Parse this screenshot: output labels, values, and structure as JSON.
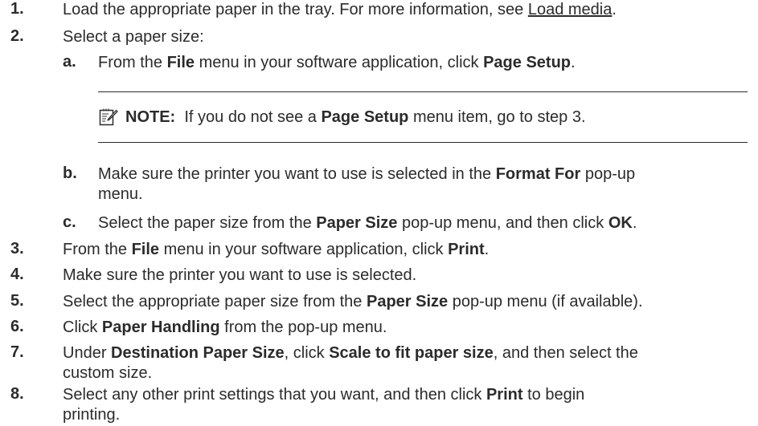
{
  "steps": [
    {
      "num": "1.",
      "parts": [
        {
          "t": "Load the appropriate paper in the tray. For more information, see "
        },
        {
          "t": "Load media",
          "link": true
        },
        {
          "t": "."
        }
      ]
    },
    {
      "num": "2.",
      "parts": [
        {
          "t": "Select a paper size:"
        }
      ]
    },
    {
      "num": "a.",
      "sub": true,
      "parts": [
        {
          "t": "From the "
        },
        {
          "t": "File",
          "b": true
        },
        {
          "t": " menu in your software application, click "
        },
        {
          "t": "Page Setup",
          "b": true
        },
        {
          "t": "."
        }
      ]
    },
    {
      "num": "b.",
      "sub": true,
      "parts": [
        {
          "t": "Make sure the printer you want to use is selected in the "
        },
        {
          "t": "Format For",
          "b": true
        },
        {
          "t": " pop-up"
        },
        {
          "br": true
        },
        {
          "t": "menu."
        }
      ]
    },
    {
      "num": "c.",
      "sub": true,
      "parts": [
        {
          "t": "Select the paper size from the "
        },
        {
          "t": "Paper Size",
          "b": true
        },
        {
          "t": " pop-up menu, and then click "
        },
        {
          "t": "OK",
          "b": true
        },
        {
          "t": "."
        }
      ]
    },
    {
      "num": "3.",
      "parts": [
        {
          "t": "From the "
        },
        {
          "t": "File",
          "b": true
        },
        {
          "t": " menu in your software application, click "
        },
        {
          "t": "Print",
          "b": true
        },
        {
          "t": "."
        }
      ]
    },
    {
      "num": "4.",
      "parts": [
        {
          "t": "Make sure the printer you want to use is selected."
        }
      ]
    },
    {
      "num": "5.",
      "parts": [
        {
          "t": "Select the appropriate paper size from the "
        },
        {
          "t": "Paper Size",
          "b": true
        },
        {
          "t": " pop-up menu (if available)."
        }
      ]
    },
    {
      "num": "6.",
      "parts": [
        {
          "t": "Click "
        },
        {
          "t": "Paper Handling",
          "b": true
        },
        {
          "t": " from the pop-up menu."
        }
      ]
    },
    {
      "num": "7.",
      "parts": [
        {
          "t": "Under "
        },
        {
          "t": "Destination Paper Size",
          "b": true
        },
        {
          "t": ", click "
        },
        {
          "t": "Scale to fit paper size",
          "b": true
        },
        {
          "t": ", and then select the"
        },
        {
          "br": true
        },
        {
          "t": "custom size."
        }
      ]
    },
    {
      "num": "8.",
      "parts": [
        {
          "t": "Select any other print settings that you want, and then click "
        },
        {
          "t": "Print",
          "b": true
        },
        {
          "t": " to begin"
        },
        {
          "br": true
        },
        {
          "t": "printing."
        }
      ]
    }
  ],
  "note": {
    "icon": "note-pencil-icon",
    "label": "NOTE:",
    "parts": [
      {
        "t": "If you do not see a "
      },
      {
        "t": "Page Setup",
        "b": true
      },
      {
        "t": " menu item, go to step 3."
      }
    ]
  }
}
